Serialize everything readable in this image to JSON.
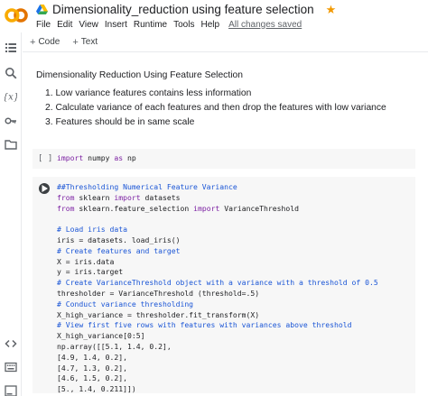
{
  "header": {
    "title": "Dimensionality_reduction using feature selection",
    "star": "★",
    "menu": [
      "File",
      "Edit",
      "View",
      "Insert",
      "Runtime",
      "Tools",
      "Help"
    ],
    "saved_status": "All changes saved"
  },
  "toolbar": {
    "add_code_label": "Code",
    "add_text_label": "Text"
  },
  "text_cell": {
    "heading": "Dimensionality Reduction Using Feature Selection",
    "items": [
      "1. Low variance features contains less information",
      "2. Calculate variance of each features and then drop the features with low variance",
      "3. Features should be in same scale"
    ]
  },
  "code_cell_1": {
    "prompt": "[ ]",
    "line": {
      "kw1": "import",
      "t1": " numpy ",
      "kw2": "as",
      "t2": " np"
    }
  },
  "code_cell_2": {
    "lines": [
      {
        "comment": "##Thresholding Numerical Feature Variance"
      },
      {
        "kw": "from",
        "t1": " sklearn ",
        "kw2": "import",
        "t2": " datasets"
      },
      {
        "kw": "from",
        "t1": " sklearn.feature_selection ",
        "kw2": "import",
        "t2": " VarianceThreshold"
      },
      {
        "blank": ""
      },
      {
        "comment": "# Load iris data"
      },
      {
        "code": "iris = datasets. load_iris()"
      },
      {
        "comment": "# Create features and target"
      },
      {
        "code": "X = iris.data"
      },
      {
        "code": "y = iris.target"
      },
      {
        "comment": "# Create VarianceThreshold object with a variance with a threshold of 0.5"
      },
      {
        "code": "thresholder = VarianceThreshold (threshold=.5)"
      },
      {
        "comment": "# Conduct variance thresholding"
      },
      {
        "code": "X_high_variance = thresholder.fit_transform(X)"
      },
      {
        "comment": "# View first five rows with features with variances above threshold"
      },
      {
        "code": "X_high_variance[0:5]"
      },
      {
        "code": "np.array([[5.1, 1.4, 0.2],"
      },
      {
        "code": "[4.9, 1.4, 0.2],"
      },
      {
        "code": "[4.7, 1.3, 0.2],"
      },
      {
        "code": "[4.6, 1.5, 0.2],"
      },
      {
        "code": "[5., 1.4, 0.211]])"
      }
    ]
  },
  "colors": {
    "accent_orange": "#f9ab00",
    "comment_blue": "#1a55d6",
    "keyword_purple": "#7b1fa2",
    "cell_bg": "#f7f7f7"
  }
}
